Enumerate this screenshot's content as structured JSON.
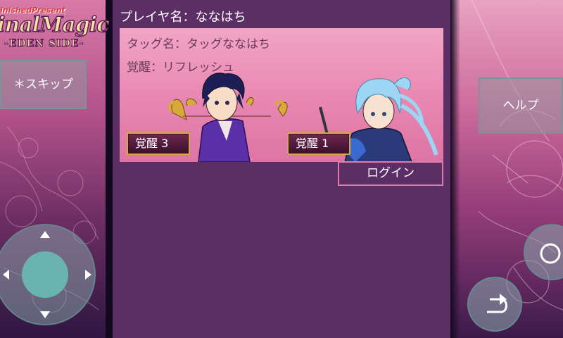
{
  "logo": {
    "small": "inishedPresent",
    "main": "inalMagic",
    "sub": "-EDEN SIDE-"
  },
  "panel": {
    "player_name": "プレイヤ名：ななはち",
    "tag_name": "タッグ名：タッグななはち",
    "awakening": "覚醒：リフレッシュ",
    "badge_left": "覚醒 3",
    "badge_right": "覚醒 1",
    "login_label": "ログイン"
  },
  "controls": {
    "skip_label": "＊スキップ",
    "help_label": "ヘルプ",
    "circle_icon": "circle-icon",
    "return_icon": "return-arrow-icon",
    "dpad_icon": "dpad-icon"
  },
  "colors": {
    "panel": "#5b2e66",
    "card": "#e886b1",
    "login_border": "#dd7ca7",
    "badge_border": "#d4a84a"
  }
}
